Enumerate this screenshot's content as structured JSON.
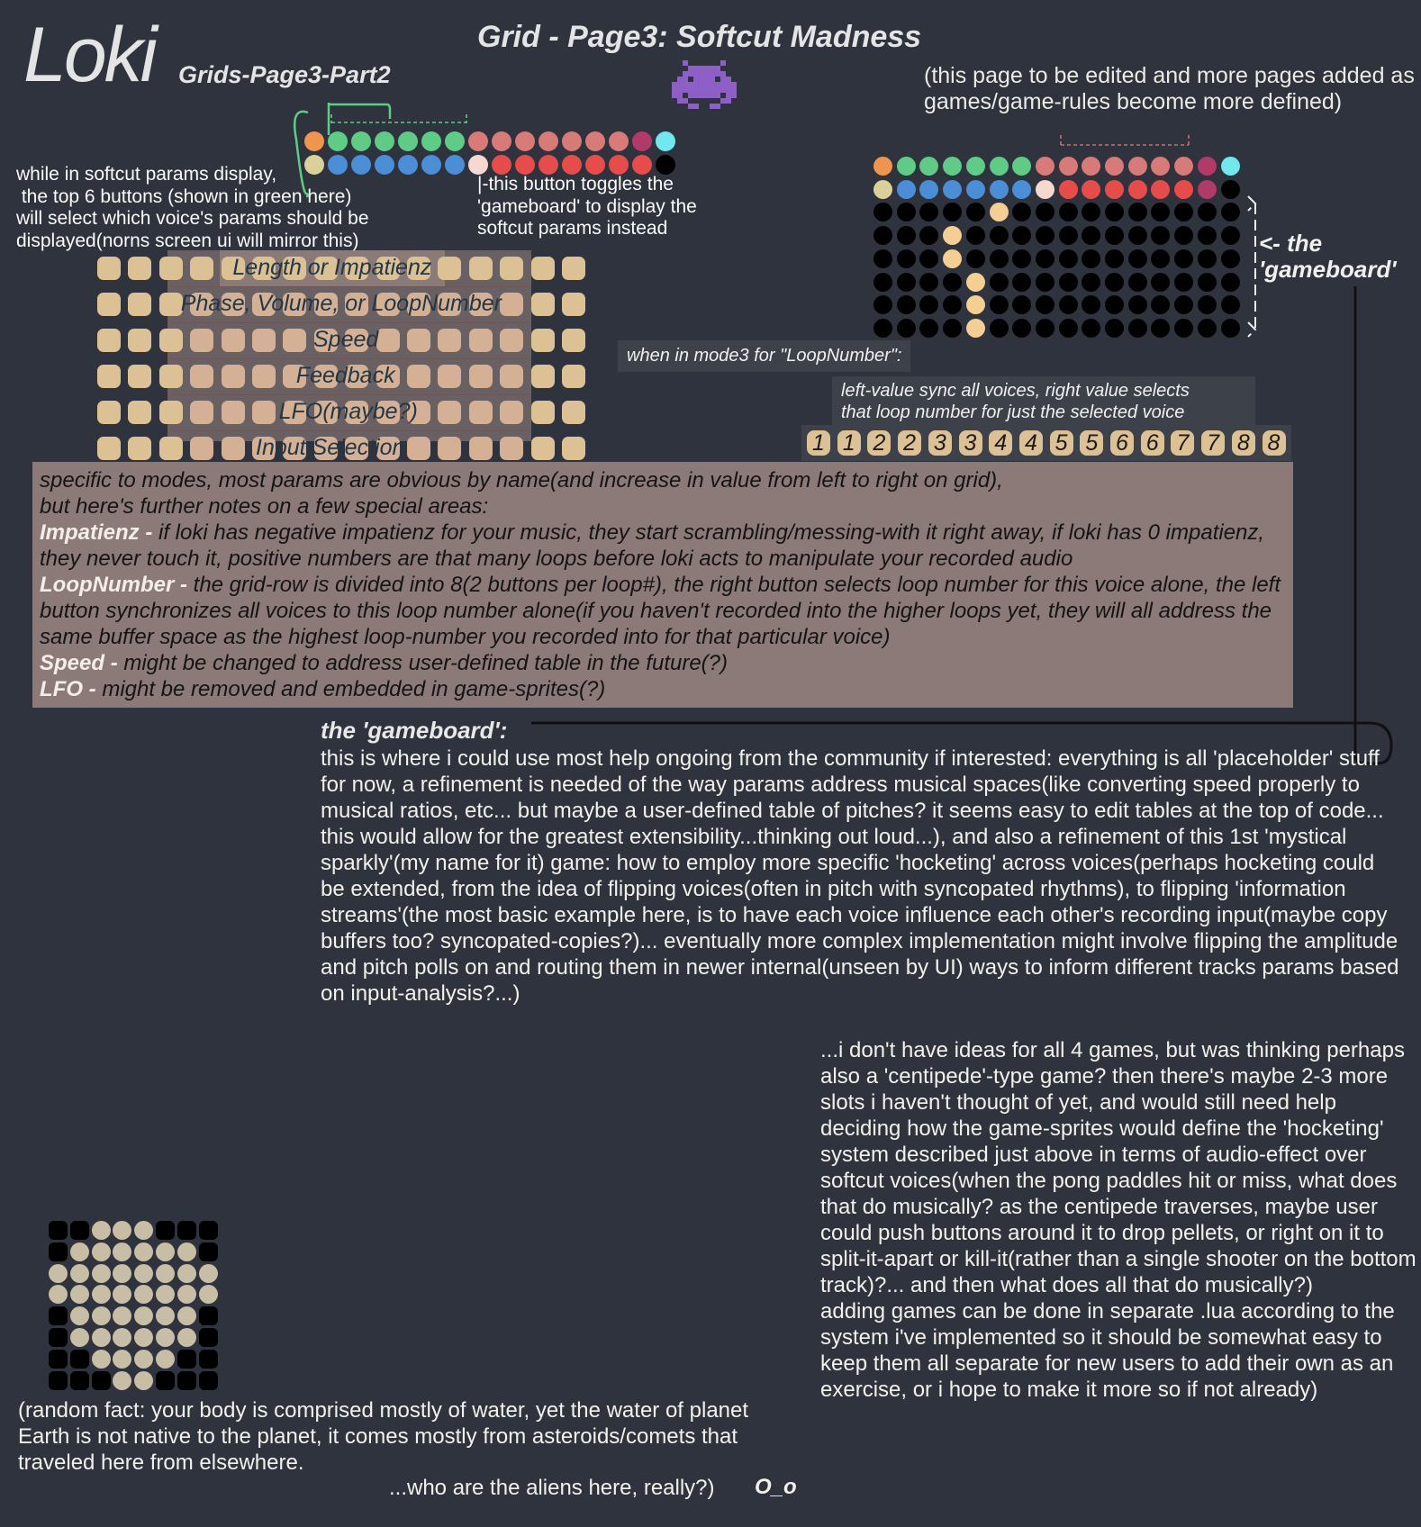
{
  "header": {
    "logo": "Loki",
    "subtitle": "Grids-Page3-Part2",
    "title": "Grid - Page3: Softcut Madness",
    "note": "(this page to be edited and more pages added as games/game-rules become more defined)"
  },
  "colors": {
    "background": "#2e333d",
    "orange": "#f0954e",
    "green": "#5fcc86",
    "blue": "#4a8ed8",
    "pink": "#d77a78",
    "red": "#e84c4a",
    "magenta": "#b23a68",
    "cyan": "#6fe8ee",
    "cream": "#d9d09a",
    "pale": "#f6d8d0",
    "black": "#000000",
    "button_tan": "#dcc194",
    "gameboard_on": "#f5cf92",
    "box_bg": "#8c7a78"
  },
  "top_grid": {
    "row1": [
      "orange",
      "green",
      "green",
      "green",
      "green",
      "green",
      "green",
      "pink",
      "pink",
      "pink",
      "pink",
      "pink",
      "pink",
      "pink",
      "magenta",
      "cyan"
    ],
    "row2": [
      "cream",
      "blue",
      "blue",
      "blue",
      "blue",
      "blue",
      "blue",
      "pale",
      "red",
      "red",
      "red",
      "red",
      "red",
      "red",
      "red",
      "black"
    ]
  },
  "annotations": {
    "voice_select": "while in softcut params display,\n the top 6 buttons (shown in green here)\nwill select which voice's params should be\ndisplayed(norns screen ui will mirror this)",
    "toggle": "|-this button toggles the\n'gameboard' to display the\nsoftcut params instead",
    "gameboard_label": "<- the\n'gameboard'",
    "mode3_title": "when in mode3 for \"LoopNumber\":",
    "mode3_desc": "left-value sync all voices, right value selects\nthat loop number for just the selected voice"
  },
  "param_rows": [
    "Length or Impatienz",
    "Phase, Volume, or LoopNumber",
    "Speed",
    "Feedback",
    "LFO(maybe?)",
    "Input Selection"
  ],
  "gameboard": {
    "row1": [
      "orange",
      "green",
      "green",
      "green",
      "green",
      "green",
      "green",
      "pink",
      "pink",
      "pink",
      "pink",
      "pink",
      "pink",
      "pink",
      "magenta",
      "cyan"
    ],
    "row2": [
      "cream",
      "blue",
      "blue",
      "blue",
      "blue",
      "blue",
      "blue",
      "pale",
      "red",
      "red",
      "red",
      "red",
      "red",
      "red",
      "magenta",
      "black"
    ],
    "lit": [
      [
        0,
        5
      ],
      [
        1,
        3
      ],
      [
        2,
        3
      ],
      [
        3,
        4
      ],
      [
        4,
        4
      ],
      [
        5,
        4
      ]
    ]
  },
  "loop_numbers": [
    "1",
    "1",
    "2",
    "2",
    "3",
    "3",
    "4",
    "4",
    "5",
    "5",
    "6",
    "6",
    "7",
    "7",
    "8",
    "8"
  ],
  "notes_box": {
    "intro1": "specific to modes, most params are obvious by name(and increase in value from left to right on grid),",
    "intro2": "but here's further notes on a few special areas:",
    "items": [
      {
        "key": "Impatienz -",
        "text": " if loki has negative impatienz for your music, they start scrambling/messing-with it right away, if loki has 0 impatienz, they never touch it, positive numbers are that many loops before loki acts to manipulate your recorded audio"
      },
      {
        "key": "LoopNumber -",
        "text": "   the grid-row is divided into 8(2 buttons per loop#), the right button selects loop number for this voice alone, the left button synchronizes all voices to this loop number alone(if you haven't recorded into the higher loops yet, they will all address the same buffer space as the highest loop-number you recorded into for that particular voice)"
      },
      {
        "key": "Speed -",
        "text": "  might be changed to address user-defined table in the future(?)"
      },
      {
        "key": "LFO -",
        "text": "  might be removed and embedded in game-sprites(?)"
      }
    ]
  },
  "gameboard_section": {
    "heading": "the 'gameboard':",
    "body": "this is where i could use most help ongoing from the community if interested: everything is all 'placeholder' stuff for now, a refinement is needed of the way params address musical spaces(like converting speed properly to musical ratios, etc... but maybe a user-defined table of pitches? it seems easy to edit tables at the top of code... this would allow for the greatest extensibility...thinking out loud...), and also a refinement of this 1st 'mystical sparkly'(my name for it) game: how to employ more specific 'hocketing' across voices(perhaps hocketing could be extended, from the idea of flipping voices(often in pitch with syncopated rhythms), to flipping 'information streams'(the most basic example here, is to have each voice influence each other's recording input(maybe copy buffers too? syncopated-copies?)... eventually more complex implementation might involve flipping the amplitude and pitch polls on and routing them in newer internal(unseen by UI) ways to inform different tracks params based on input-analysis?...)"
  },
  "games_note": "...i don't have ideas for all 4 games, but was thinking perhaps also a 'centipede'-type game? then there's maybe 2-3 more slots i haven't thought of yet, and would still need help deciding how the game-sprites would define the 'hocketing' system described just above in terms of audio-effect over softcut voices(when the pong paddles hit or miss, what does that do musically? as the centipede traverses, maybe user could push buttons around it to drop pellets, or right on it to split-it-apart or kill-it(rather than a single shooter on the bottom track)?... and then what does all that do musically?)\nadding games can be done in separate .lua according to the system i've implemented so it should be somewhat easy to keep them all separate for new users to add their own as an exercise, or i hope to make it more so if not already)",
  "skull_grid": [
    "11000111",
    "10000001",
    "00000000",
    "00000000",
    "10000001",
    "10000001",
    "11000011",
    "11100111"
  ],
  "random_fact": "(random fact: your body is comprised mostly of water, yet the water of planet Earth is not native to the planet, it comes mostly from asteroids/comets that traveled here from elsewhere.",
  "aliens_line": "...who are the aliens here, really?)",
  "emoticon": "O_o",
  "invader_icon": "space-invader"
}
